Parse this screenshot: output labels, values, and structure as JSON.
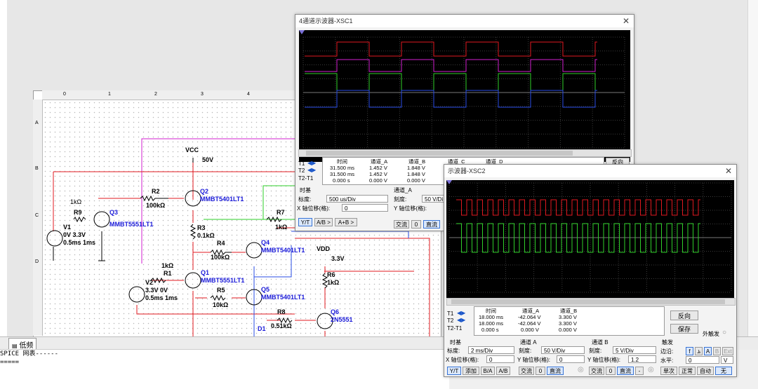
{
  "schematic": {
    "tab_label": "低频",
    "ruler_cols": [
      "0",
      "1",
      "2",
      "3",
      "4"
    ],
    "ruler_rows": [
      "A",
      "B",
      "C",
      "D"
    ],
    "labels": {
      "vcc": "VCC",
      "vcc_val": "50V",
      "vdd": "VDD",
      "vdd_val": "3.3V",
      "r9": "R9",
      "r9_val": "1kΩ",
      "q3": "Q3",
      "q3_part": "MMBT5551LT1",
      "v1": "V1",
      "v1_val": "0V 3.3V",
      "v1_time": "0.5ms 1ms",
      "r2": "R2",
      "r2_val": "100kΩ",
      "q2": "Q2",
      "q2_part": "MMBT5401LT1",
      "r3": "R3",
      "r3_val": "0.1kΩ",
      "r4": "R4",
      "r4_val": "100kΩ",
      "q4": "Q4",
      "q4_part": "MMBT5401LT1",
      "r7": "R7",
      "r7_val": "1kΩ",
      "r1": "R1",
      "r1_val": "1kΩ",
      "q1": "Q1",
      "q1_part": "MMBT5551LT1",
      "v2": "V2",
      "v2_val": "3.3V 0V",
      "v2_time": "0.5ms 1ms",
      "r5": "R5",
      "r5_val": "10kΩ",
      "q5": "Q5",
      "q5_part": "MMBT5401LT1",
      "r6": "R6",
      "r6_val": "1kΩ",
      "r8": "R8",
      "r8_val": "0.51kΩ",
      "q6": "Q6",
      "q6_part": "2N5551",
      "d1": "D1"
    }
  },
  "spice": {
    "line1": "SPICE 网表------",
    "line2": "====="
  },
  "scope1": {
    "title": "4通道示波器-XSC1",
    "headers": [
      "时间",
      "通道_A",
      "通道_B",
      "通道_C",
      "通道_D"
    ],
    "rows": [
      {
        "label": "T1",
        "time": "31.500 ms",
        "a": "1.452 V",
        "b": "1.848 V"
      },
      {
        "label": "T2",
        "time": "31.500 ms",
        "a": "1.452 V",
        "b": "1.848 V"
      },
      {
        "label": "T2-T1",
        "time": "0.000 s",
        "a": "0.000 V",
        "b": "0.000 V"
      }
    ],
    "reverse_label": "反向",
    "timebase_title": "时基",
    "scale_label": "标度:",
    "scale_value": "500 us/Div",
    "xpos_label": "X 轴位移(格):",
    "xpos_value": "0",
    "chan_title": "通道_A",
    "chan_scale_label": "刻度:",
    "chan_scale_value": "50  V/Di",
    "ypos_label": "Y 轴位移(格):",
    "buttons": [
      "Y/T",
      "A/B >",
      "A+B >"
    ],
    "coupling": [
      "交流",
      "0",
      "直流"
    ],
    "colors": {
      "a": "#e0191f",
      "b": "#d21fcf",
      "c": "#2fcf2a",
      "d": "#2a4de6"
    }
  },
  "scope2": {
    "title": "示波器-XSC2",
    "headers": [
      "时间",
      "通道_A",
      "通道_B"
    ],
    "rows": [
      {
        "label": "T1",
        "time": "18.000 ms",
        "a": "-42.064 V",
        "b": "3.300 V"
      },
      {
        "label": "T2",
        "time": "18.000 ms",
        "a": "-42.064 V",
        "b": "3.300 V"
      },
      {
        "label": "T2-T1",
        "time": "0.000 s",
        "a": "0.000 V",
        "b": "0.000 V"
      }
    ],
    "reverse_label": "反向",
    "save_label": "保存",
    "ext_trigger_label": "外触发",
    "timebase_title": "时基",
    "scale_label": "标度:",
    "scale_value": "2 ms/Div",
    "xpos_label": "X 轴位移(格):",
    "xpos_value": "0",
    "chanA_title": "通道 A",
    "chanA_scale_label": "刻度:",
    "chanA_scale_value": "50  V/Div",
    "chanA_ypos_label": "Y 轴位移(格):",
    "chanA_ypos_value": "0",
    "chanB_title": "通道 B",
    "chanB_scale_label": "刻度:",
    "chanB_scale_value": "5  V/Div",
    "chanB_ypos_label": "Y 轴位移(格):",
    "chanB_ypos_value": "1.2",
    "trigger_title": "触发",
    "edge_label": "边沿:",
    "level_label": "水平:",
    "level_value": "0",
    "level_unit": "V",
    "edge_buttons": [
      "f",
      "⫡",
      "A",
      "B",
      "Ext"
    ],
    "mode_buttons": [
      "Y/T",
      "添加",
      "B/A",
      "A/B"
    ],
    "couplingA": [
      "交流",
      "0",
      "直流"
    ],
    "couplingB": [
      "交流",
      "0",
      "直流",
      "-"
    ],
    "sweep_buttons": [
      "单次",
      "正常",
      "自动",
      "无"
    ],
    "colors": {
      "a": "#e0191f",
      "b": "#2fcf2a"
    }
  }
}
